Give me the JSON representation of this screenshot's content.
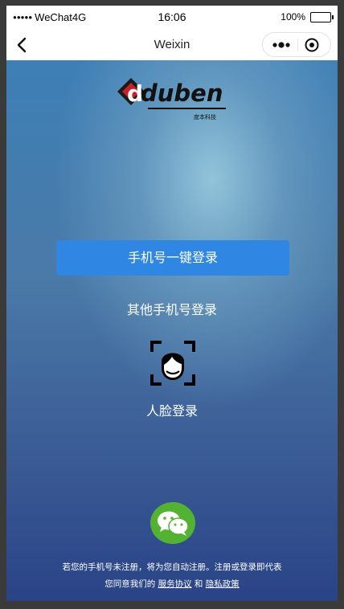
{
  "status": {
    "carrier": "WeChat4G",
    "time": "16:06",
    "battery": "100%"
  },
  "nav": {
    "title": "Weixin",
    "more_icon": "more-dots-icon",
    "close_icon": "target-close-icon"
  },
  "logo": {
    "brand_text": "duben",
    "subtitle": "度本科技"
  },
  "actions": {
    "one_click_login": "手机号一键登录",
    "other_phone_login": "其他手机号登录",
    "face_login": "人脸登录",
    "wechat_icon": "wechat-icon"
  },
  "notice": {
    "line1": "若您的手机号未注册，将为您自动注册。注册或登录即代表",
    "line2_prefix": "您同意我们的",
    "service_link": "服务协议",
    "and": "和",
    "privacy_link": "隐私政策"
  },
  "colors": {
    "primary_button": "#2f86e3",
    "wechat_green": "#53b232"
  }
}
